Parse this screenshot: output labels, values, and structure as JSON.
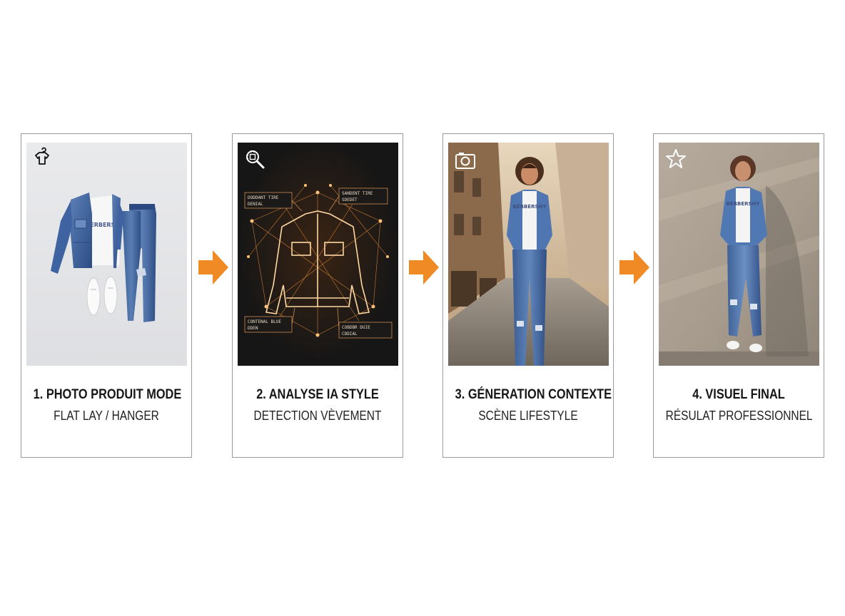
{
  "steps": [
    {
      "title": "1. PHOTO PRODUIT MODE",
      "subtitle": "FLAT LAY / HANGER",
      "icon": "hanger-tshirt-icon"
    },
    {
      "title": "2. ANALYSE IA STYLE",
      "subtitle": "DETECTION VÈVEMENT",
      "icon": "magnifier-chip-icon",
      "annotations": [
        "DODDANT TIRE\nDENIAL",
        "SANDENT TIRE\nSDEDET",
        "CONTENAL BLUE\nDDEN",
        "COBDBR DUIE\nCDDIAL"
      ]
    },
    {
      "title": "3. GÉNERATION CONTEXTE",
      "subtitle": "SCÈNE LIFESTYLE",
      "icon": "camera-icon"
    },
    {
      "title": "4. VISUEL FINAL",
      "subtitle": "RÉSULAT PROFESSIONNEL",
      "icon": "star-icon"
    }
  ],
  "shirt_print": "BERBERSHY",
  "colors": {
    "arrow": "#f08a24",
    "card_border": "#9a9a9a",
    "glow": "#ff9a3a"
  }
}
